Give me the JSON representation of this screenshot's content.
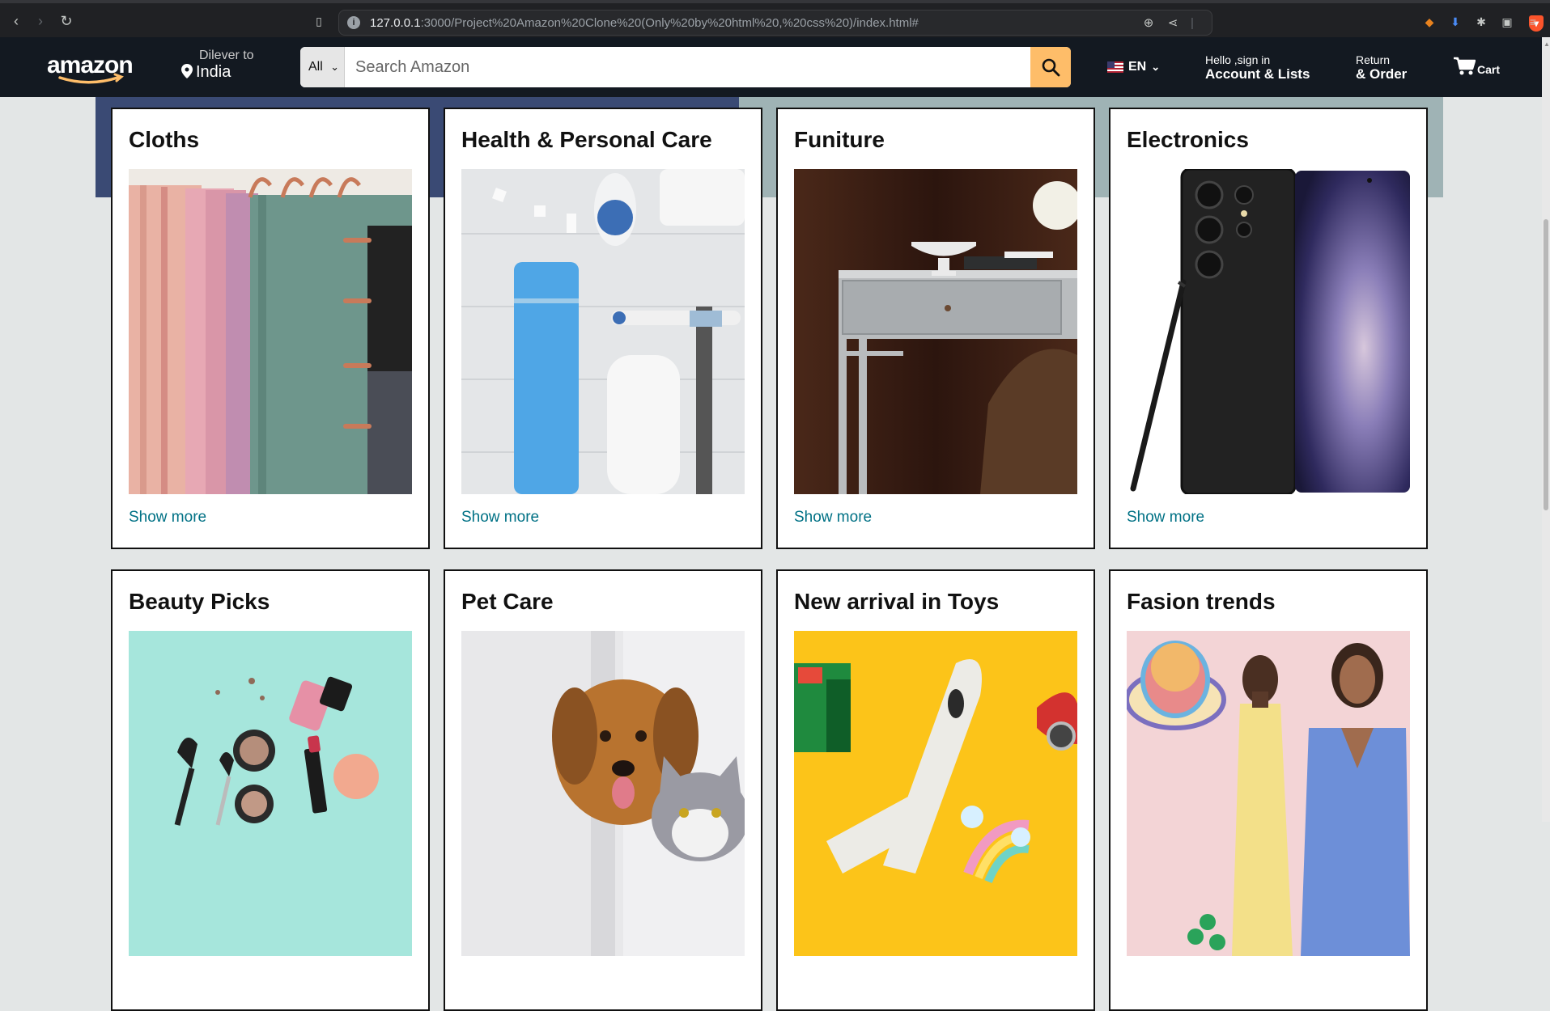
{
  "browser": {
    "url_host": "127.0.0.1",
    "url_rest": ":3000/Project%20Amazon%20Clone%20(Only%20by%20html%20,%20css%20)/index.html#"
  },
  "nav": {
    "logo": "amazon",
    "deliver_label": "Dilever to",
    "deliver_location": "India",
    "search_category": "All",
    "search_placeholder": "Search Amazon",
    "language": "EN",
    "account_small": "Hello ,sign in",
    "account_big": "Account & Lists",
    "returns_small": "Return",
    "returns_big": "& Order",
    "cart_label": "Cart",
    "accent_color": "#febd69",
    "bg_color": "#131921"
  },
  "cards": [
    {
      "title": "Cloths",
      "link": "Show more",
      "image": "folded-towels"
    },
    {
      "title": "Health & Personal Care",
      "link": "Show more",
      "image": "personal-care-products"
    },
    {
      "title": "Funiture",
      "link": "Show more",
      "image": "grey-desk"
    },
    {
      "title": "Electronics",
      "link": "Show more",
      "image": "smartphone-with-stylus"
    },
    {
      "title": "Beauty Picks",
      "link": "",
      "image": "makeup-items"
    },
    {
      "title": "Pet Care",
      "link": "",
      "image": "dog-and-cat"
    },
    {
      "title": "New arrival in Toys",
      "link": "",
      "image": "toy-airplane"
    },
    {
      "title": "Fasion trends",
      "link": "",
      "image": "fashion-models"
    }
  ]
}
